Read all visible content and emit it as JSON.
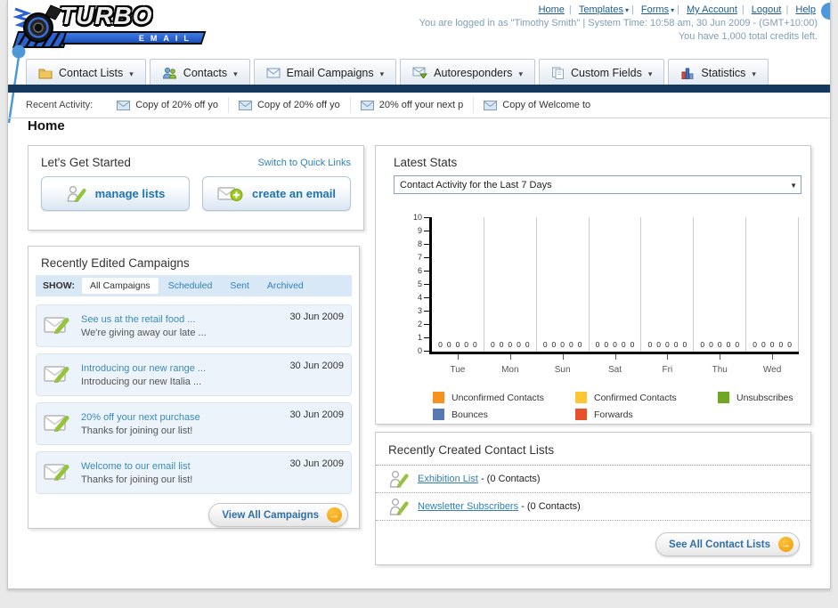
{
  "brand": {
    "name": "TURBO",
    "sub": "EMAIL"
  },
  "header": {
    "links": [
      {
        "label": "Home",
        "dropdown": false
      },
      {
        "label": "Templates",
        "dropdown": true
      },
      {
        "label": "Forms",
        "dropdown": true
      },
      {
        "label": "My Account",
        "dropdown": false
      },
      {
        "label": "Logout",
        "dropdown": false
      },
      {
        "label": "Help",
        "dropdown": false
      }
    ],
    "login_text": "You are logged in as \"Timothy Smith\" | System Time: 10:58 am, 30 Jun 2009 - (GMT+10:00)",
    "credits_text": "You have 1,000 total credits left."
  },
  "nav_tabs": [
    {
      "label": "Contact Lists",
      "icon": "folder-icon"
    },
    {
      "label": "Contacts",
      "icon": "contacts-icon"
    },
    {
      "label": "Email Campaigns",
      "icon": "envelope-icon"
    },
    {
      "label": "Autoresponders",
      "icon": "autoresponder-icon"
    },
    {
      "label": "Custom Fields",
      "icon": "custom-fields-icon"
    },
    {
      "label": "Statistics",
      "icon": "statistics-icon"
    }
  ],
  "recent_activity": {
    "label": "Recent Activity:",
    "items": [
      "Copy of 20% off yo",
      "Copy of 20% off yo",
      "20% off your next p",
      "Copy of Welcome to"
    ]
  },
  "page_title": "Home",
  "get_started": {
    "title": "Let's Get Started",
    "switch_link": "Switch to Quick Links",
    "buttons": [
      {
        "label": "manage lists"
      },
      {
        "label": "create an email"
      }
    ]
  },
  "campaigns": {
    "title": "Recently Edited Campaigns",
    "show_label": "SHOW:",
    "filters": [
      {
        "label": "All Campaigns",
        "active": true
      },
      {
        "label": "Scheduled",
        "active": false
      },
      {
        "label": "Sent",
        "active": false
      },
      {
        "label": "Archived",
        "active": false
      }
    ],
    "items": [
      {
        "title": "See us at the retail food ...",
        "subtitle": "We're giving away our late ...",
        "date": "30 Jun 2009"
      },
      {
        "title": "Introducing our new range ...",
        "subtitle": "Introducing our new Italia ...",
        "date": "30 Jun 2009"
      },
      {
        "title": "20% off your next purchase",
        "subtitle": "Thanks for joining our list!",
        "date": "30 Jun 2009"
      },
      {
        "title": "Welcome to our email list",
        "subtitle": "Thanks for joining our list!",
        "date": "30 Jun 2009"
      }
    ],
    "view_all_label": "View All Campaigns"
  },
  "latest_stats": {
    "title": "Latest Stats",
    "dropdown_value": "Contact Activity for the Last 7 Days",
    "chart_data": {
      "type": "bar",
      "title": "Contact Activity for the Last 7 Days",
      "categories": [
        "Tue",
        "Mon",
        "Sun",
        "Sat",
        "Fri",
        "Thu",
        "Wed"
      ],
      "series": [
        {
          "name": "Unconfirmed Contacts",
          "color": "#f6921e",
          "values": [
            0,
            0,
            0,
            0,
            0,
            0,
            0
          ]
        },
        {
          "name": "Confirmed Contacts",
          "color": "#fcc732",
          "values": [
            0,
            0,
            0,
            0,
            0,
            0,
            0
          ]
        },
        {
          "name": "Unsubscribes",
          "color": "#71a823",
          "values": [
            0,
            0,
            0,
            0,
            0,
            0,
            0
          ]
        },
        {
          "name": "Bounces",
          "color": "#5878b4",
          "values": [
            0,
            0,
            0,
            0,
            0,
            0,
            0
          ]
        },
        {
          "name": "Forwards",
          "color": "#e8502c",
          "values": [
            0,
            0,
            0,
            0,
            0,
            0,
            0
          ]
        }
      ],
      "ylim": [
        0,
        10
      ],
      "ytick_step": 1,
      "grid": "vertical",
      "legend_position": "bottom"
    }
  },
  "contact_lists": {
    "title": "Recently Created Contact Lists",
    "items": [
      {
        "name": "Exhibition List",
        "suffix": "- (0 Contacts)"
      },
      {
        "name": "Newsletter Subscribers",
        "suffix": "- (0 Contacts)"
      }
    ],
    "see_all_label": "See All Contact Lists"
  }
}
